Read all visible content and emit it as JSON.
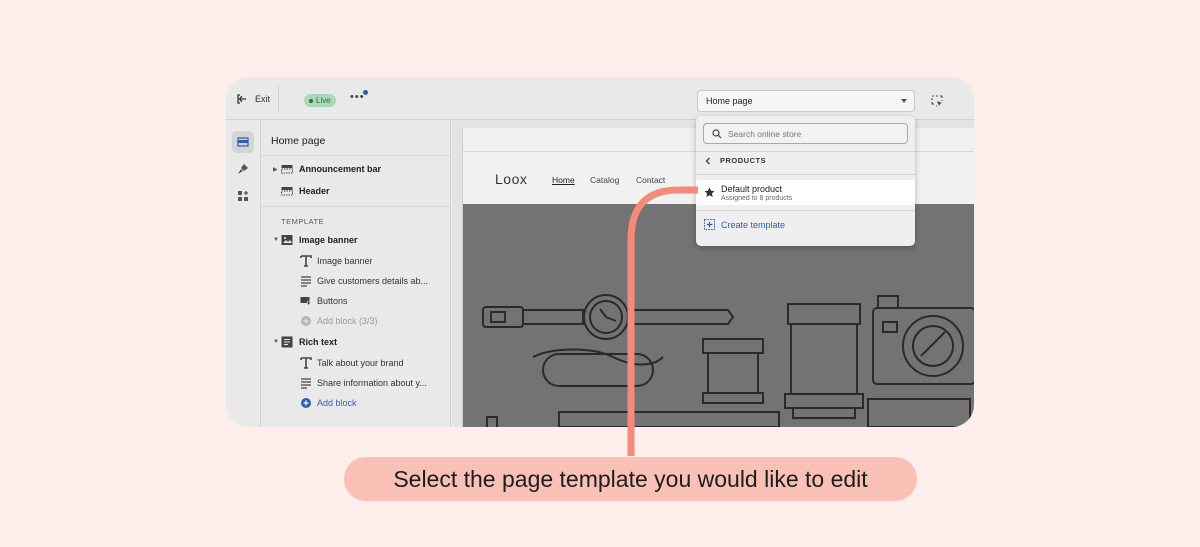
{
  "topbar": {
    "exit_label": "Exit",
    "status_badge": "Live",
    "more_label": "•••",
    "page_select_value": "Home page"
  },
  "sidebar": {
    "title": "Home page",
    "section_label": "TEMPLATE",
    "items": [
      {
        "label": "Announcement bar"
      },
      {
        "label": "Header"
      },
      {
        "label": "Image banner"
      },
      {
        "label": "Image banner"
      },
      {
        "label": "Give customers details ab..."
      },
      {
        "label": "Buttons"
      },
      {
        "label": "Add block (3/3)"
      },
      {
        "label": "Rich text"
      },
      {
        "label": "Talk about your brand"
      },
      {
        "label": "Share information about y..."
      },
      {
        "label": "Add block"
      }
    ]
  },
  "preview": {
    "logo": "Loox",
    "nav": [
      "Home",
      "Catalog",
      "Contact"
    ]
  },
  "dropdown": {
    "search_placeholder": "Search online store",
    "back_label": "PRODUCTS",
    "item_name": "Default product",
    "item_sub": "Assigned to 8 products",
    "create_label": "Create template"
  },
  "callout": {
    "text": "Select the page template you would like to edit"
  },
  "colors": {
    "background": "#fdeeeb",
    "accent_line": "#f58a78",
    "callout_fill": "#f9c1b6",
    "link_blue": "#2c5fb0"
  }
}
